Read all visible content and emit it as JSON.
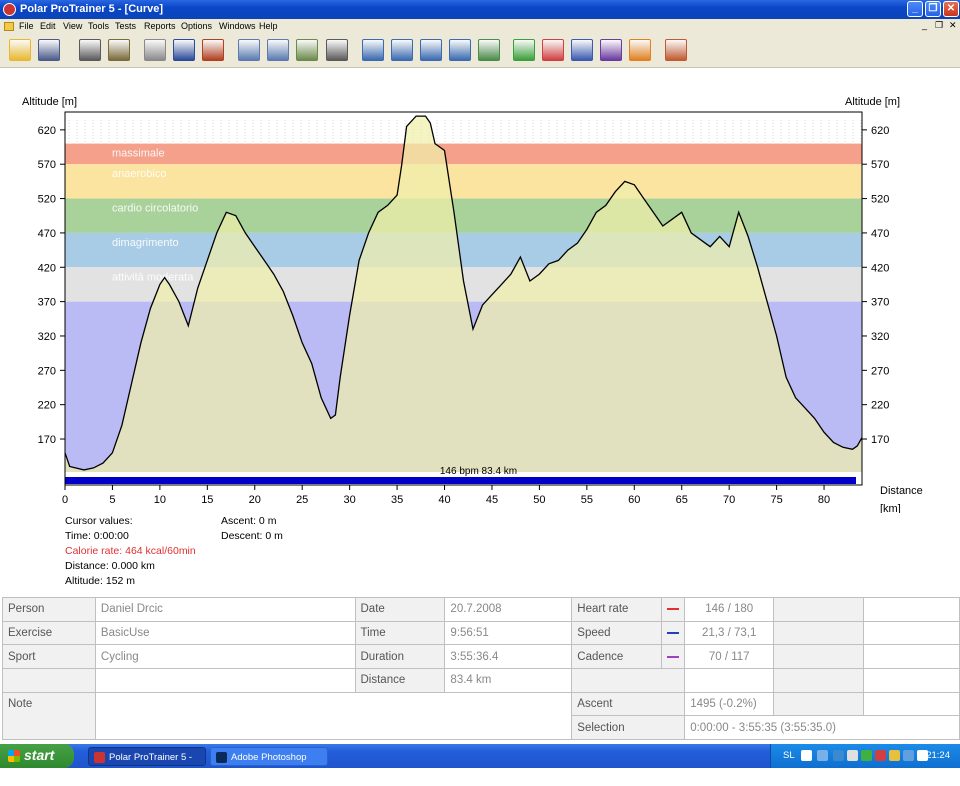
{
  "window": {
    "title": "Polar ProTrainer 5 - [Curve]",
    "buttons": {
      "minimize": "_",
      "restore": "❐",
      "close": "✕"
    }
  },
  "menu": {
    "items": [
      "File",
      "Edit",
      "View",
      "Tools",
      "Tests",
      "Reports",
      "Options",
      "Windows",
      "Help"
    ],
    "mdi_controls": [
      "_",
      "❐",
      "✕"
    ]
  },
  "toolbar": {
    "buttons": [
      {
        "icon": "open-folder-icon",
        "color": "#e8b830"
      },
      {
        "icon": "save-icon",
        "color": "#4a5a8a"
      },
      {
        "icon": "download-exercise-icon",
        "color": "#5a5a5a"
      },
      {
        "icon": "settings-exercise-icon",
        "color": "#7a6a3a"
      },
      {
        "icon": "calendar-icon",
        "color": "#8a8a8a"
      },
      {
        "icon": "book-icon",
        "color": "#2a4a9a"
      },
      {
        "icon": "fitness-test-icon",
        "color": "#b04020"
      },
      {
        "icon": "curve-icon",
        "color": "#5a7ab0"
      },
      {
        "icon": "bar-chart-icon",
        "color": "#5a7ab0"
      },
      {
        "icon": "percent-icon",
        "color": "#6a8a4a"
      },
      {
        "icon": "table-icon",
        "color": "#5a5a5a"
      },
      {
        "icon": "zoom-icon",
        "color": "#3a6ab0"
      },
      {
        "icon": "weight-icon",
        "color": "#3a6ab0"
      },
      {
        "icon": "scale-icon",
        "color": "#3a6ab0"
      },
      {
        "icon": "stopwatch-icon",
        "color": "#3a6ab0"
      },
      {
        "icon": "smooth-curve-icon",
        "color": "#4a8a4a"
      },
      {
        "icon": "view1-icon",
        "color": "#3aa03a"
      },
      {
        "icon": "view2-icon",
        "color": "#d04040"
      },
      {
        "icon": "view3-icon",
        "color": "#3a5ab0"
      },
      {
        "icon": "view4-icon",
        "color": "#6a3aa0"
      },
      {
        "icon": "view5-icon",
        "color": "#e08020"
      },
      {
        "icon": "users-icon",
        "color": "#c05a30"
      }
    ]
  },
  "chart_data": {
    "type": "area",
    "ylabel": "Altitude [m]",
    "ylabel_right": "Altitude [m]",
    "xlabel": "Distance",
    "xlabel_unit": "[km]",
    "xlim": [
      0,
      84
    ],
    "ylim": [
      122,
      646
    ],
    "x_ticks": [
      0,
      5,
      10,
      15,
      20,
      25,
      30,
      35,
      40,
      45,
      50,
      55,
      60,
      65,
      70,
      75,
      80
    ],
    "y_ticks": [
      170,
      220,
      270,
      320,
      370,
      420,
      470,
      520,
      570,
      620
    ],
    "zones": [
      {
        "name": "massimale",
        "from": 570,
        "to": 600,
        "color": "#f4a08a"
      },
      {
        "name": "anaerobico",
        "from": 520,
        "to": 570,
        "color": "#fbe3a0"
      },
      {
        "name": "cardio circolatorio",
        "from": 470,
        "to": 520,
        "color": "#a8d29a"
      },
      {
        "name": "dimagrimento",
        "from": 420,
        "to": 470,
        "color": "#a8cce6"
      },
      {
        "name": "attività moderata",
        "from": 370,
        "to": 420,
        "color": "#e2e2e2"
      },
      {
        "name": "",
        "from": 122,
        "to": 370,
        "color": "#babaf4"
      }
    ],
    "series": [
      {
        "x": [
          0,
          0.5,
          2,
          3,
          4,
          5,
          6,
          7,
          8,
          9,
          10,
          10.5,
          11,
          12,
          13,
          14,
          15,
          16,
          17,
          18,
          19,
          20,
          21,
          22,
          23,
          24,
          25,
          26,
          27,
          28,
          28.5,
          29,
          30,
          31,
          32,
          33,
          34,
          35,
          35.5,
          36,
          37,
          38,
          38.5,
          39,
          40,
          41,
          42,
          43,
          44,
          45,
          46,
          47,
          48,
          49,
          50,
          51,
          52,
          53,
          54,
          55,
          56,
          57,
          58,
          59,
          60,
          61,
          62,
          63,
          64,
          65,
          66,
          67,
          68,
          69,
          70,
          71,
          72,
          73,
          74,
          75,
          76,
          77,
          78,
          79,
          80,
          81,
          82,
          83,
          83.5,
          84
        ],
        "y": [
          150,
          130,
          125,
          128,
          135,
          150,
          190,
          250,
          310,
          360,
          395,
          405,
          395,
          370,
          335,
          390,
          430,
          470,
          500,
          495,
          470,
          450,
          430,
          410,
          385,
          350,
          310,
          280,
          230,
          200,
          205,
          260,
          350,
          430,
          470,
          500,
          510,
          525,
          570,
          625,
          640,
          640,
          630,
          600,
          590,
          500,
          400,
          330,
          365,
          380,
          395,
          410,
          435,
          400,
          410,
          425,
          430,
          445,
          455,
          475,
          500,
          510,
          530,
          545,
          540,
          520,
          500,
          480,
          490,
          500,
          470,
          460,
          450,
          465,
          450,
          500,
          465,
          420,
          370,
          320,
          260,
          230,
          215,
          200,
          180,
          165,
          158,
          155,
          160,
          172
        ]
      }
    ],
    "readout": "146 bpm 83.4 km"
  },
  "cursor": {
    "label": "Cursor values:",
    "time": "Time: 0:00:00",
    "calorie": "Calorie rate: 464 kcal/60min",
    "distance": "Distance: 0.000 km",
    "altitude": "Altitude: 152 m",
    "ascent": "Ascent: 0 m",
    "descent": "Descent: 0 m",
    "calorie_color": "#e03030"
  },
  "info": {
    "person_label": "Person",
    "person": "Daniel Drcic",
    "exercise_label": "Exercise",
    "exercise": "BasicUse",
    "sport_label": "Sport",
    "sport": "Cycling",
    "note_label": "Note",
    "date_label": "Date",
    "date": "20.7.2008",
    "time_label": "Time",
    "time": "9:56:51",
    "duration_label": "Duration",
    "duration": "3:55:36.4",
    "distance_label": "Distance",
    "distance": "83.4 km",
    "hr_label": "Heart rate",
    "hr": "146 / 180",
    "hr_color": "#e03030",
    "speed_label": "Speed",
    "speed": "21,3 / 73,1",
    "speed_color": "#2040c0",
    "cadence_label": "Cadence",
    "cadence": "70 / 117",
    "cadence_color": "#a040c0",
    "ascent_label": "Ascent",
    "ascent": "1495 (-0.2%)",
    "selection_label": "Selection",
    "selection": "0:00:00 - 3:55:35 (3:55:35.0)"
  },
  "taskbar": {
    "start": "start",
    "tasks": [
      "Polar ProTrainer 5 - [...",
      "Adobe Photoshop"
    ],
    "tray_lang": "SL",
    "clock": "21:24"
  }
}
